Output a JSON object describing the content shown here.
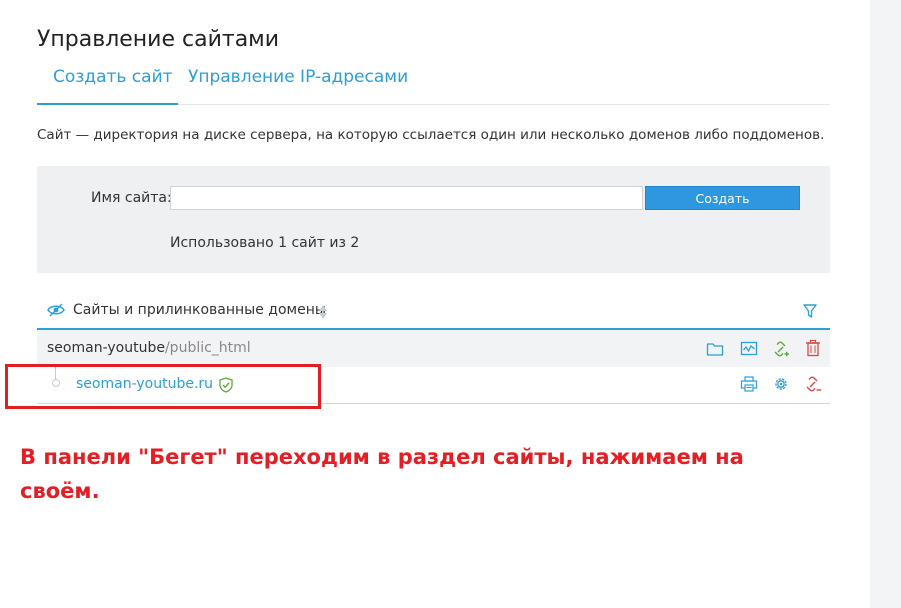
{
  "page": {
    "title": "Управление сайтами"
  },
  "tabs": [
    {
      "label": "Создать сайт",
      "active": true
    },
    {
      "label": "Управление IP-адресами",
      "active": false
    }
  ],
  "description": "Сайт — директория на диске сервера, на которую ссылается один или несколько доменов либо поддоменов.",
  "create_form": {
    "name_label": "Имя сайта:",
    "name_value": "",
    "create_button": "Создать",
    "usage_text": "Использовано 1 сайт из 2"
  },
  "sites_table": {
    "header_label": "Сайты и прилинкованные домены",
    "header_icons": [
      "eye-icon",
      "sort-icon",
      "filter-icon"
    ],
    "site": {
      "name": "seoman-youtube",
      "subpath": "/public_html",
      "actions": [
        "folder-icon",
        "monitor-icon",
        "link-add-icon",
        "trash-icon"
      ]
    },
    "domain": {
      "name": "seoman-youtube.ru",
      "status_icon": "shield-check-icon",
      "actions": [
        "printer-icon",
        "gear-icon",
        "unlink-icon"
      ]
    }
  },
  "annotation": {
    "text": "В панели \"Бегет\" переходим в раздел сайты, нажимаем на своём."
  },
  "colors": {
    "accent": "#2b9fd6",
    "button": "#2d97e0",
    "panel_bg": "#eef0f2",
    "annotation": "#e31e24",
    "icon_green": "#5aaa3a",
    "icon_red": "#d84848"
  }
}
